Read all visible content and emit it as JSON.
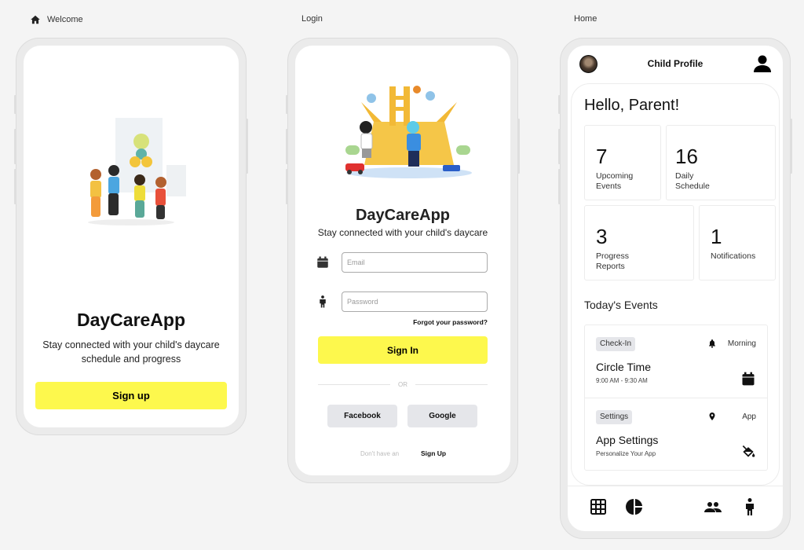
{
  "screens": {
    "welcome": {
      "label": "Welcome",
      "label_icon": "home-icon",
      "illustration": "children-playing-with-balloons",
      "title": "DayCareApp",
      "subtitle": "Stay connected with your child's daycare schedule and progress",
      "cta_label": "Sign up"
    },
    "login": {
      "label": "Login",
      "illustration": "children-on-playground",
      "title": "DayCareApp",
      "subtitle": "Stay connected with your child's daycare",
      "email_icon": "calendar-icon",
      "email_placeholder": "Email",
      "email_value": "",
      "password_icon": "child-icon",
      "password_placeholder": "Password",
      "password_value": "",
      "forgot_label": "Forgot your password?",
      "signin_label": "Sign In",
      "or_label": "OR",
      "facebook_label": "Facebook",
      "google_label": "Google",
      "no_account_text": "Don't have an",
      "signup_label": "Sign Up"
    },
    "home": {
      "label": "Home",
      "header_title": "Child Profile",
      "avatar": "user-avatar",
      "profile_icon": "person-icon",
      "greeting": "Hello, Parent!",
      "stats": [
        {
          "value": "7",
          "label_line1": "Upcoming",
          "label_line2": "Events"
        },
        {
          "value": "16",
          "label_line1": "Daily",
          "label_line2": "Schedule"
        },
        {
          "value": "3",
          "label_line1": "Progress",
          "label_line2": "Reports"
        },
        {
          "value": "1",
          "label_line1": "Notifications",
          "label_line2": ""
        }
      ],
      "section_title": "Today's Events",
      "events": [
        {
          "chip": "Check-In",
          "mini_icon": "bell-icon",
          "right_label": "Morning",
          "title": "Circle Time",
          "subtitle": "9:00 AM - 9:30 AM",
          "icon": "calendar-icon"
        },
        {
          "chip": "Settings",
          "mini_icon": "location-pin-icon",
          "right_label": "App",
          "title": "App Settings",
          "subtitle": "Personalize Your App",
          "icon": "paint-bucket-icon"
        }
      ],
      "tabs": [
        {
          "icon": "grid-icon"
        },
        {
          "icon": "pie-chart-icon"
        },
        {
          "icon": "people-icon"
        },
        {
          "icon": "child-icon"
        }
      ]
    }
  },
  "colors": {
    "accent_yellow": "#fdf84d",
    "neutral_button": "#e5e6ea",
    "background": "#f4f4f4"
  }
}
